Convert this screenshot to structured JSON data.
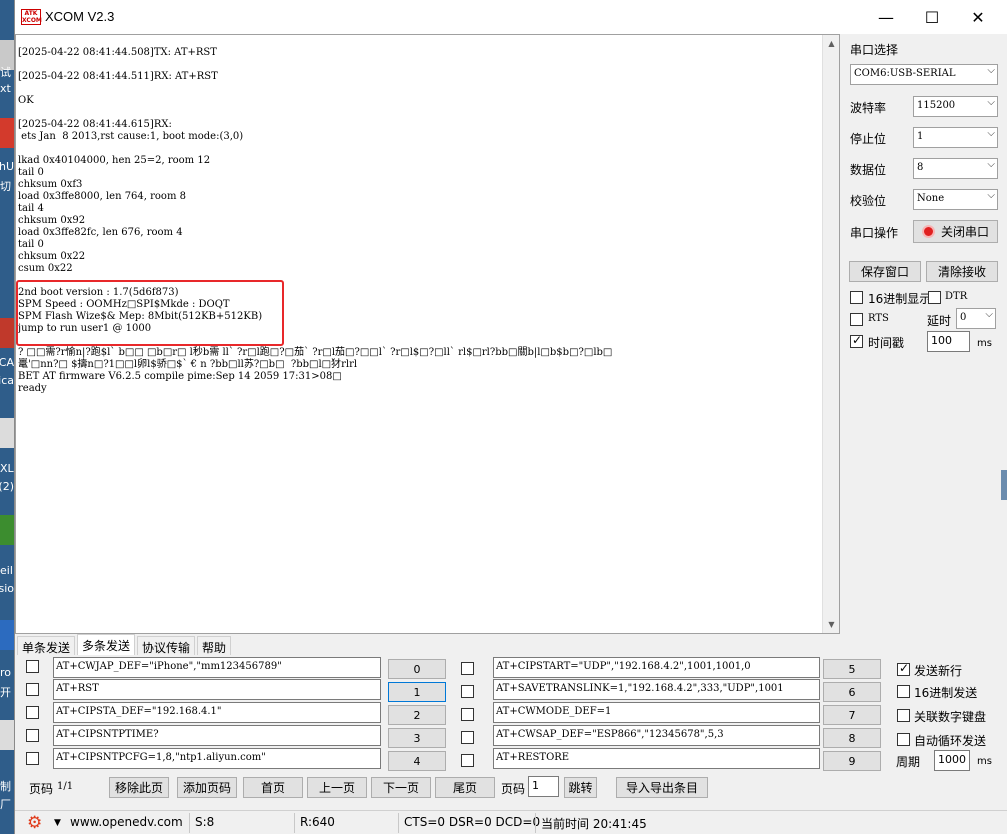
{
  "window": {
    "logo_text": "ATK XCOM",
    "title": "XCOM V2.3",
    "minimize": "—",
    "maximize": "☐",
    "close": "✕"
  },
  "desktop": {
    "labels": [
      "试",
      "xt",
      "hU",
      "切",
      "CA",
      "ica",
      "XL",
      "(2)",
      "eil",
      "sio",
      "ro",
      "开",
      "制",
      "厂"
    ]
  },
  "receive": {
    "lines": "[2025-04-22 08:41:44.508]TX: AT+RST\n\n[2025-04-22 08:41:44.511]RX: AT+RST\n\nOK\n\n[2025-04-22 08:41:44.615]RX:\n ets Jan  8 2013,rst cause:1, boot mode:(3,0)\n\nlkad 0x40104000, hen 25=2, room 12\ntail 0\nchksum 0xf3\nload 0x3ffe8000, len 764, room 8\ntail 4\nchksum 0x92\nload 0x3ffe82fc, len 676, room 4\ntail 0\nchksum 0x22\ncsum 0x22\n\n2nd boot version : 1.7(5d6f873)\nSPM Speed : OOMHz□SPI$Mkde : DOQT\nSPM Flash Wize$& Mep: 8Mbit(512KB+512KB)\njump to run user1 @ 1000\n\n? □□需?r愉n|?跑$l` b□□ □b□r□ l秒b需 ll` ?r□l跑□?□茄` ?r□l茄□?□□l` ?r□l$□?□ll` rl$□rl?bb□關b|l□b$b□?□lb□\n鼍'□nn?□ $擣n□?1□□l卵l$骄□$` € n ?bb□ll苏?□b□  ?bb□l□犲rlrl\nBET AT firmware V6.2.5 compile pime:Sep 14 2059 17:31>08□\nready"
  },
  "settings": {
    "port_label": "串口选择",
    "port_value": "COM6:USB-SERIAL",
    "baud_label": "波特率",
    "baud_value": "115200",
    "stop_label": "停止位",
    "stop_value": "1",
    "data_label": "数据位",
    "data_value": "8",
    "parity_label": "校验位",
    "parity_value": "None",
    "op_label": "串口操作",
    "op_button": "关闭串口",
    "save_button": "保存窗口",
    "clear_button": "清除接收",
    "hex_display": "16进制显示",
    "dtr": "DTR",
    "rts": "RTS",
    "delay_label": "延时",
    "delay_value": "0",
    "timestamp": "时间戳",
    "timestamp_value": "100",
    "ms": "ms"
  },
  "tabs": [
    "单条发送",
    "多条发送",
    "协议传输",
    "帮助"
  ],
  "multi": {
    "left": [
      {
        "cmd": "AT+CWJAP_DEF=\"iPhone\",\"mm123456789\"",
        "num": "0"
      },
      {
        "cmd": "AT+RST",
        "num": "1"
      },
      {
        "cmd": "AT+CIPSTA_DEF=\"192.168.4.1\"",
        "num": "2"
      },
      {
        "cmd": "AT+CIPSNTPTIME?",
        "num": "3"
      },
      {
        "cmd": "AT+CIPSNTPCFG=1,8,\"ntp1.aliyun.com\"",
        "num": "4"
      }
    ],
    "right": [
      {
        "cmd": "AT+CIPSTART=\"UDP\",\"192.168.4.2\",1001,1001,0",
        "num": "5"
      },
      {
        "cmd": "AT+SAVETRANSLINK=1,\"192.168.4.2\",333,\"UDP\",1001",
        "num": "6"
      },
      {
        "cmd": "AT+CWMODE_DEF=1",
        "num": "7"
      },
      {
        "cmd": "AT+CWSAP_DEF=\"ESP866\",\"12345678\",5,3",
        "num": "8"
      },
      {
        "cmd": "AT+RESTORE",
        "num": "9"
      }
    ],
    "opt_newline": "发送新行",
    "opt_hex": "16进制发送",
    "opt_keyboard": "关联数字键盘",
    "opt_loop": "自动循环发送",
    "period_label": "周期",
    "period_value": "1000",
    "ms": "ms"
  },
  "paging": {
    "page_info_label": "页码",
    "page_info": "1/1",
    "remove": "移除此页",
    "add": "添加页码",
    "first": "首页",
    "prev": "上一页",
    "next": "下一页",
    "last": "尾页",
    "page_label": "页码",
    "page_value": "1",
    "jump": "跳转",
    "import_export": "导入导出条目"
  },
  "status": {
    "site": "www.openedv.com",
    "sent": "S:8",
    "received": "R:640",
    "lines": "CTS=0 DSR=0 DCD=0",
    "time": "当前时间 20:41:45"
  }
}
